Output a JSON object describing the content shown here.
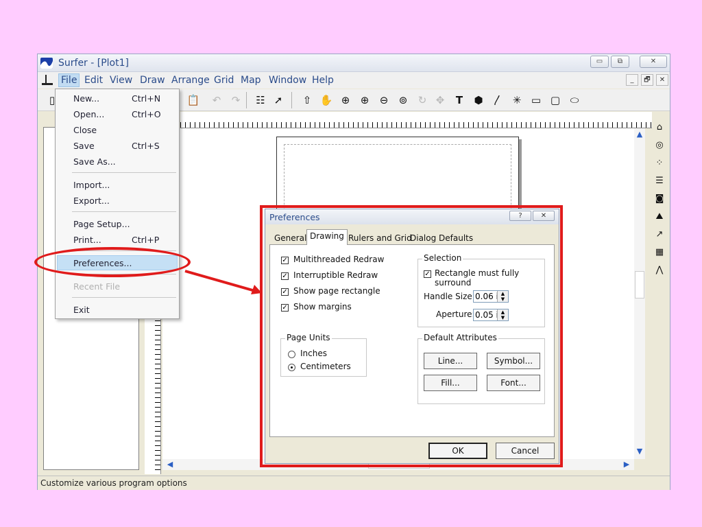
{
  "window": {
    "title": "Surfer - [Plot1]",
    "controls": {
      "minimize": "▭",
      "restore": "⧉",
      "close": "✕"
    },
    "mdi_controls": {
      "minimize": "_",
      "restore": "🗗",
      "close": "✕"
    }
  },
  "menubar": {
    "items": [
      "File",
      "Edit",
      "View",
      "Draw",
      "Arrange",
      "Grid",
      "Map",
      "Window",
      "Help"
    ]
  },
  "toolbar": {
    "icons": [
      "new-icon",
      "paste-icon",
      "undo-icon",
      "redo-icon",
      "object-manager-icon",
      "context-help-icon",
      "select-arrow-icon",
      "pan-hand-icon",
      "zoom-realtime-icon",
      "zoom-in-icon",
      "zoom-out-icon",
      "zoom-rectangle-icon",
      "rotate-icon",
      "reshape-icon",
      "text-tool-icon",
      "polygon-tool-icon",
      "polyline-tool-icon",
      "symbol-tool-icon",
      "rectangle-tool-icon",
      "rounded-rectangle-tool-icon",
      "ellipse-tool-icon"
    ]
  },
  "sidebar_tools": [
    "base-map-icon",
    "contour-map-icon",
    "post-map-icon",
    "classed-post-map-icon",
    "image-map-icon",
    "shaded-relief-map-icon",
    "vector-map-icon",
    "wireframe-icon",
    "surface-icon"
  ],
  "file_menu": {
    "items": [
      {
        "label": "New...",
        "shortcut": "Ctrl+N"
      },
      {
        "label": "Open...",
        "shortcut": "Ctrl+O"
      },
      {
        "label": "Close",
        "shortcut": ""
      },
      {
        "label": "Save",
        "shortcut": "Ctrl+S"
      },
      {
        "label": "Save As...",
        "shortcut": ""
      },
      {
        "label": "Import...",
        "shortcut": ""
      },
      {
        "label": "Export...",
        "shortcut": ""
      },
      {
        "label": "Page Setup...",
        "shortcut": ""
      },
      {
        "label": "Print...",
        "shortcut": "Ctrl+P"
      },
      {
        "label": "Preferences...",
        "shortcut": ""
      },
      {
        "label": "Recent File",
        "shortcut": ""
      },
      {
        "label": "Exit",
        "shortcut": ""
      }
    ]
  },
  "status": {
    "text": "Customize various program options"
  },
  "dialog": {
    "title": "Preferences",
    "help_label": "?",
    "close_label": "✕",
    "tabs": [
      "General",
      "Drawing",
      "Rulers and Grid",
      "Dialog Defaults"
    ],
    "selected_tab": "Drawing",
    "checkboxes": [
      {
        "label": "Multithreaded Redraw",
        "checked": true
      },
      {
        "label": "Interruptible Redraw",
        "checked": true
      },
      {
        "label": "Show page rectangle",
        "checked": true
      },
      {
        "label": "Show margins",
        "checked": true
      }
    ],
    "page_units": {
      "title": "Page Units",
      "options": [
        "Inches",
        "Centimeters"
      ],
      "selected": "Centimeters"
    },
    "selection": {
      "title": "Selection",
      "rectangle_label": "Rectangle must fully surround",
      "rectangle_checked": true,
      "handle_size_label": "Handle Size:",
      "handle_size_value": "0.06 in",
      "aperture_label": "Aperture:",
      "aperture_value": "0.05 in"
    },
    "default_attributes": {
      "title": "Default Attributes",
      "line": "Line...",
      "symbol": "Symbol...",
      "fill": "Fill...",
      "font": "Font..."
    },
    "ok": "OK",
    "cancel": "Cancel"
  },
  "highlight_color": "#e01b1b"
}
